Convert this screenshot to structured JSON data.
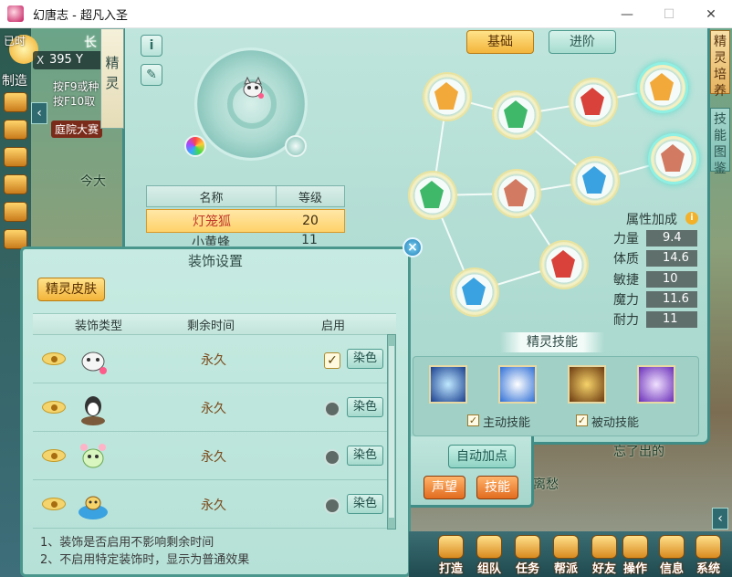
{
  "window": {
    "title": "幻唐志 - 超凡入圣",
    "min": "—",
    "max": "☐",
    "close": "✕"
  },
  "hud": {
    "sun_label": "已时",
    "coords": "395 Y",
    "made": "制造",
    "hint1": "按F9或种",
    "hint2": "按F10取",
    "yard_tag": "庭院大赛",
    "scene_top": "长",
    "scene_mid": "今大",
    "scene_bottom1": "离愁",
    "scene_bottom2": "忘了出的"
  },
  "side_tabs": [
    "精灵培养",
    "技能图鉴"
  ],
  "spirit_panel": {
    "vertical_tab": "精灵",
    "info_btn": "i",
    "edit_btn": "✎",
    "tabs": {
      "basic": "基础",
      "advanced": "进阶"
    },
    "table": {
      "headers": [
        "名称",
        "等级"
      ],
      "rows": [
        {
          "name": "灯笼狐",
          "level": "20"
        },
        {
          "name": "小黄蜂",
          "level": "11"
        }
      ]
    },
    "attr_title": "属性加成",
    "attributes": [
      {
        "label": "力量",
        "value": "9.4"
      },
      {
        "label": "体质",
        "value": "14.6"
      },
      {
        "label": "敏捷",
        "value": "10"
      },
      {
        "label": "魔力",
        "value": "11.6"
      },
      {
        "label": "耐力",
        "value": "11"
      }
    ],
    "skill_title": "精灵技能",
    "active_label": "主动技能",
    "passive_label": "被动技能",
    "auto_add": "自动加点",
    "reputation": "声望",
    "skill_btn": "技能"
  },
  "decoration_dialog": {
    "title": "装饰设置",
    "close": "×",
    "skin_tab": "精灵皮肤",
    "headers": {
      "type": "装饰类型",
      "remaining": "剩余时间",
      "enable": "启用"
    },
    "rows": [
      {
        "remaining": "永久",
        "enabled": true,
        "dye": "染色"
      },
      {
        "remaining": "永久",
        "enabled": false,
        "dye": "染色"
      },
      {
        "remaining": "永久",
        "enabled": false,
        "dye": "染色"
      },
      {
        "remaining": "永久",
        "enabled": false,
        "dye": "染色"
      }
    ],
    "notes": [
      "1、装饰是否启用不影响剩余时间",
      "2、不启用特定装饰时，显示为普通效果"
    ]
  },
  "bottom_menu": [
    "打造",
    "组队",
    "任务",
    "帮派",
    "好友",
    "操作",
    "信息",
    "系统"
  ],
  "colors": {
    "panel": "#a6d6cc",
    "border": "#3f8d86",
    "accent": "#f3b43a",
    "selected_row": "#ffd26a"
  }
}
